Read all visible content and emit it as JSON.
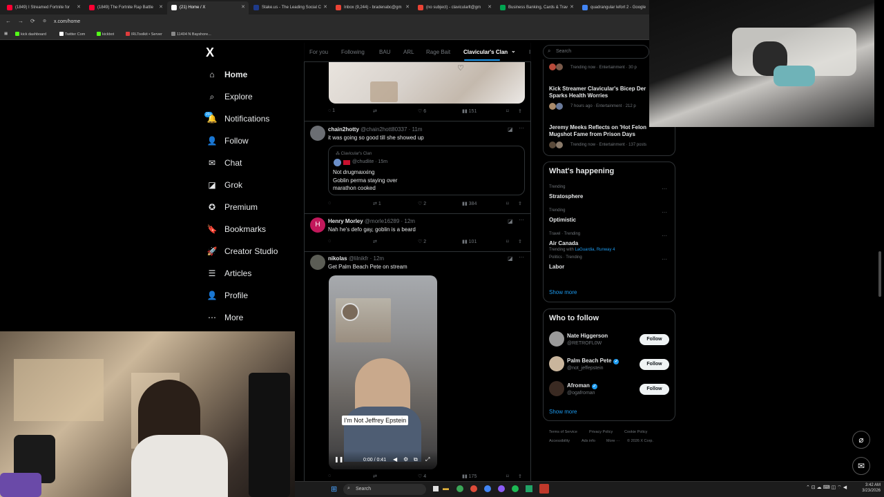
{
  "browser": {
    "tabs": [
      {
        "title": "(1849) I Streamed Fortnite for",
        "color": "#ff0033"
      },
      {
        "title": "(1849) The Fortnite Rap Battle",
        "color": "#ff0033"
      },
      {
        "title": "(21) Home / X",
        "color": "#ffffff"
      },
      {
        "title": "Stake.us - The Leading Social C",
        "color": "#1e3a8a"
      },
      {
        "title": "Inbox (9,244) - bradenabc@gm",
        "color": "#ea4335"
      },
      {
        "title": "(no subject) - clavicularlt@gm",
        "color": "#ea4335"
      },
      {
        "title": "Business Banking, Cards & Trav",
        "color": "#00a651"
      },
      {
        "title": "quadrangular lefort 2 - Google",
        "color": "#4285f4"
      }
    ],
    "url": "x.com/home",
    "bookmarks": [
      {
        "label": "kick dashboard",
        "color": "#53fc18"
      },
      {
        "label": "Twitter Com",
        "color": "#ffffff"
      },
      {
        "label": "kickbot",
        "color": "#53fc18"
      },
      {
        "label": "IRLToolkit • Server",
        "color": "#e03c3c"
      },
      {
        "label": "11404 N Bayshore...",
        "color": "#888888"
      }
    ]
  },
  "sidebar": {
    "logo": "X",
    "badge": "20+",
    "items": [
      {
        "label": "Home",
        "icon": "home-icon",
        "glyph": "⌂"
      },
      {
        "label": "Explore",
        "icon": "search-icon",
        "glyph": "⌕"
      },
      {
        "label": "Notifications",
        "icon": "bell-icon",
        "glyph": "🔔"
      },
      {
        "label": "Follow",
        "icon": "add-user-icon",
        "glyph": "👤"
      },
      {
        "label": "Chat",
        "icon": "mail-icon",
        "glyph": "✉"
      },
      {
        "label": "Grok",
        "icon": "grok-icon",
        "glyph": "◪"
      },
      {
        "label": "Premium",
        "icon": "premium-icon",
        "glyph": "✪"
      },
      {
        "label": "Bookmarks",
        "icon": "bookmark-icon",
        "glyph": "🔖"
      },
      {
        "label": "Creator Studio",
        "icon": "rocket-icon",
        "glyph": "🚀"
      },
      {
        "label": "Articles",
        "icon": "article-icon",
        "glyph": "☰"
      },
      {
        "label": "Profile",
        "icon": "profile-icon",
        "glyph": "👤"
      },
      {
        "label": "More",
        "icon": "more-icon",
        "glyph": "⋯"
      }
    ]
  },
  "feed": {
    "tabs": [
      "For you",
      "Following",
      "BAU",
      "ARL",
      "Rage Bait",
      "Clavicular's Clan",
      "I"
    ],
    "active_tab": "Clavicular's Clan",
    "post0": {
      "replies": "1",
      "reposts": "",
      "likes": "6",
      "views": "151"
    },
    "post1": {
      "name": "chain2hotty",
      "handle": "@chain2hott80337 · 11m",
      "text": "it was going so good till she showed up",
      "quote_community": "Clavicular's Clan",
      "quote_handle": "@chudlite · 15m",
      "quote_lines": [
        "Not drugmaxxing",
        "Goblin perma staying over",
        "marathon cooked"
      ],
      "replies": "",
      "reposts": "1",
      "likes": "2",
      "views": "384"
    },
    "post2": {
      "avatar_letter": "H",
      "name": "Henry Morley",
      "handle": "@morle16289 · 12m",
      "text": "Nah he's defo gay, goblin is a beard",
      "replies": "",
      "reposts": "",
      "likes": "2",
      "views": "101"
    },
    "post3": {
      "name": "nikolas",
      "handle": "@lilnikfr · 12m",
      "text": "Get Palm Beach Pete on stream",
      "caption": "I'm Not Jeffrey Epstein",
      "video_time": "0:00 / 0:41",
      "replies": "",
      "reposts": "",
      "likes": "4",
      "views": "175"
    }
  },
  "right": {
    "search_placeholder": "Search",
    "trending_top": [
      {
        "title": "",
        "meta": "Trending now · Entertainment · 30 p"
      },
      {
        "title": "Kick Streamer Clavicular's Bicep Der",
        "title2": "Sparks Health Worries",
        "meta": "7 hours ago · Entertainment · 212 p"
      },
      {
        "title": "Jeremy Meeks Reflects on 'Hot Felon",
        "title2": "Mugshot Fame from Prison Days",
        "meta": "Trending now · Entertainment · 137 posts"
      }
    ],
    "happening_title": "What's happening",
    "happening": [
      {
        "context": "Trending",
        "topic": "Stratosphere",
        "extra": ""
      },
      {
        "context": "Trending",
        "topic": "Optimistic",
        "extra": ""
      },
      {
        "context": "Travel · Trending",
        "topic": "Air Canada",
        "extra_prefix": "Trending with ",
        "extra": "LaGuardia, Runway 4"
      },
      {
        "context": "Politics · Trending",
        "topic": "Labor",
        "extra": ""
      }
    ],
    "show_more": "Show more",
    "who_title": "Who to follow",
    "who": [
      {
        "name": "Nate Higgerson",
        "handle": "@RETROFL0W",
        "verified": false,
        "button": "Follow"
      },
      {
        "name": "Palm Beach Pete",
        "handle": "@not_jeffepstein",
        "verified": true,
        "button": "Follow"
      },
      {
        "name": "Afroman",
        "handle": "@ogafroman",
        "verified": true,
        "button": "Follow"
      }
    ],
    "who_show_more": "Show more",
    "footer": [
      "Terms of Service",
      "Privacy Policy",
      "Cookie Policy",
      "Accessibility",
      "Ads info",
      "More ···",
      "© 2026 X Corp."
    ]
  },
  "taskbar": {
    "search": "Search",
    "time": "3:42 AM",
    "date": "3/23/2026"
  },
  "colors": {
    "accent": "#1d9bf0",
    "background": "#000000",
    "border": "#2f3336",
    "muted": "#71767b"
  }
}
